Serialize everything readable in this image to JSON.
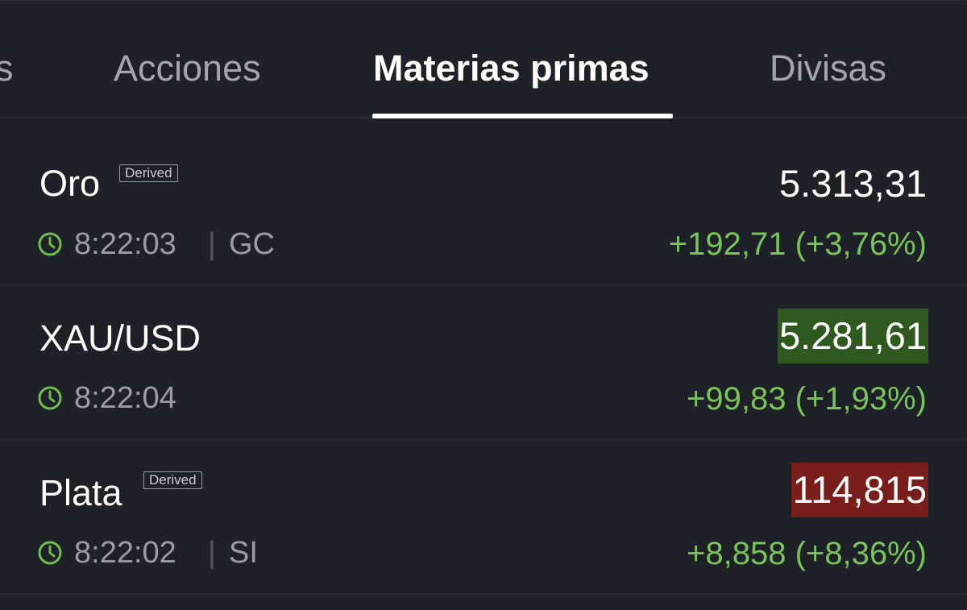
{
  "tabs": [
    {
      "label": "s",
      "active": false
    },
    {
      "label": "Acciones",
      "active": false
    },
    {
      "label": "Materias primas",
      "active": true
    },
    {
      "label": "Divisas",
      "active": false
    }
  ],
  "rows": [
    {
      "name": "Oro",
      "badge": "Derived",
      "time": "8:22:03",
      "separator": "|",
      "symbol": "GC",
      "price": "5.313,31",
      "price_highlight": "none",
      "change": "+192,71 (+3,76%)"
    },
    {
      "name": "XAU/USD",
      "time": "8:22:04",
      "price": "5.281,61",
      "price_highlight": "green",
      "change": "+99,83 (+1,93%)"
    },
    {
      "name": "Plata",
      "badge": "Derived",
      "time": "8:22:02",
      "separator": "|",
      "symbol": "SI",
      "price": "114,815",
      "price_highlight": "red",
      "change": "+8,858 (+8,36%)"
    }
  ],
  "colors": {
    "background": "#1f2128",
    "positive": "#7ac35a",
    "highlight_green": "#2e5a1f",
    "highlight_red": "#7a1e1c",
    "clock": "#6fbf4f"
  }
}
